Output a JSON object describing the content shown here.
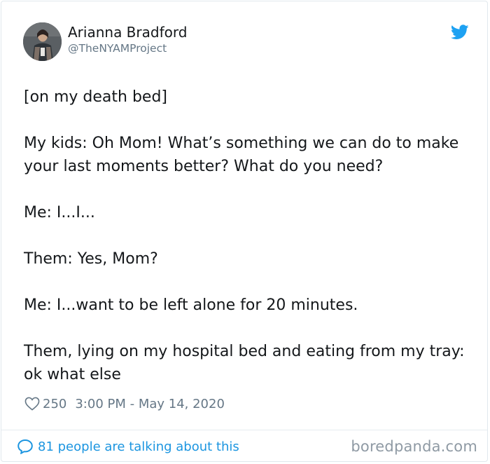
{
  "author": {
    "display_name": "Arianna Bradford",
    "handle": "@TheNYAMProject"
  },
  "tweet": {
    "paragraphs": [
      "[on my death bed]",
      "My kids: Oh Mom! What’s something we can do to make your last moments better? What do you need?",
      "Me: I...I...",
      "Them: Yes, Mom?",
      "Me: I...want to be left alone for 20 minutes.",
      "Them, lying on my hospital bed and eating from my tray: ok what else"
    ]
  },
  "meta": {
    "likes": "250",
    "timestamp": "3:00 PM - May 14, 2020"
  },
  "footer": {
    "conversation": "81 people are talking about this"
  },
  "watermark": "boredpanda.com",
  "colors": {
    "twitter_blue": "#1da1f2",
    "link_blue": "#1b95e0",
    "text": "#14171a",
    "muted": "#657786"
  },
  "icons": {
    "brand": "twitter-bird-icon",
    "like": "heart-outline-icon",
    "reply": "speech-bubble-icon"
  }
}
